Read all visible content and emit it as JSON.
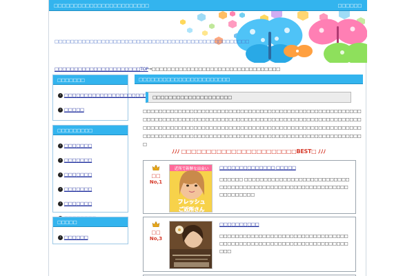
{
  "header": {
    "site_title": "□□□□□□□□□□□□□□□□□□□□□□□□",
    "top_right_link": "□□□□□□",
    "description": "□□□□□□□□□□□□□□□□□□□□□□□□□□□□□□□□□□□□□□□□□□□□□□□□□□"
  },
  "breadcrumb": {
    "home": "□□□□□□□□□□□□□□□□□□□□□□TOP",
    "separator": "→",
    "current": "□□□□□□□□□□□□□□□□□□□□□□□□□□□□□□□□□"
  },
  "sidebar": [
    {
      "heading": "□□□□□□□",
      "items": [
        "□□□□□□□□□□□□□□□□□□□□□□",
        "□□□□□"
      ]
    },
    {
      "heading": "□□□□□□□□□",
      "items": [
        "□□□□□□□",
        "□□□□□□□",
        "□□□□□□□",
        "□□□□□□□",
        "□□□□□□□",
        "□□□□□□□□"
      ]
    },
    {
      "heading": "□□□□□",
      "items": [
        "□□□□□□"
      ]
    }
  ],
  "main": {
    "heading": "□□□□□□□□□□□□□□□□□□□□□□□",
    "subheading": "□□□□□□□□□□□□□□□□□□□□",
    "body_text": "□□□□□□□□□□□□□□□□□□□□□□□□□□□□□□□□□□□□□□□□□□□□□□□□□□□□□□□□□□□□□□□□□□□□□□□□□□□□□□□□□□□□□□□□□□□□□□□□□□□□□□□□□□□□□□□□□□□□□□□□□□□□□□□□□□□□□□□□□□□□□□□□□□□□□□□□□□□□□□□□□□□□□□□□□□□□□□□□□□□□□□□□□□□□□□□□□□□□□□□□□□□□□□□□□□□□□□□□□□□□□□□□□",
    "best_heading": "ﾉﾉﾉ □□□□□□□□□□□□□□□□□□□□□□□BEST□ ﾉﾉﾉ",
    "rankings": [
      {
        "rank_label": "□□",
        "rank_no": "No,1",
        "title": "□□□□□□□□□□□□□□ □□□□□",
        "text": "□□□□□□ □□□□□□□□□□□□□□□□□□□□□□□□□□□□□□□□□□□□□□□□□□□□□□□□□□□□□□□□□□□□□□□□□□□□□",
        "image_caption_top": "近所で新鮮な出会い",
        "image_caption_main": "フレッシュ",
        "image_caption_sub": "ご近所さん"
      },
      {
        "rank_label": "□□",
        "rank_no": "No,3",
        "title": "□□□□□□□□□□",
        "text": "□□□□□□□□□□□□□□□□□□□□□□□□□□□□□□□□□□□□□□□□□□□□□□□□□□□□□□□□□□□□□□□□□□□□□",
        "image_caption_top": "",
        "image_caption_main": "",
        "image_caption_sub": ""
      }
    ]
  },
  "colors": {
    "accent": "#33b4ee",
    "link": "#1a2a9c",
    "rank_red": "#d63a2a"
  }
}
